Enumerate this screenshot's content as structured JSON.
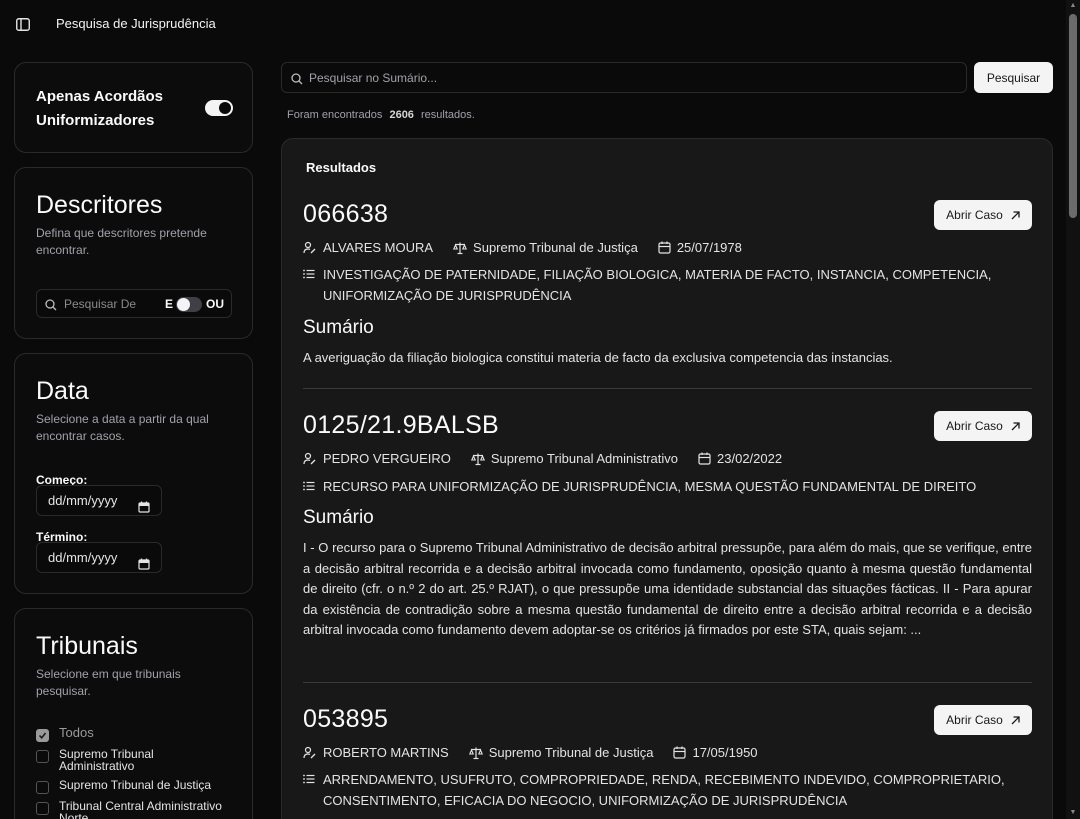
{
  "header": {
    "title": "Pesquisa de Jurisprudência"
  },
  "filters": {
    "toggle_label": "Apenas Acordãos Uniformizadores",
    "toggle_on": true,
    "descritores": {
      "title": "Descritores",
      "subtitle": "Defina que descritores pretende encontrar.",
      "search_placeholder": "Pesquisar Descritores",
      "and_label": "E",
      "or_label": "OU"
    },
    "data": {
      "title": "Data",
      "subtitle": "Selecione a data a partir da qual encontrar casos.",
      "start_label": "Começo:",
      "end_label": "Término:",
      "start_placeholder": "dd/mm/yyyy",
      "end_placeholder": "dd/mm/yyyy"
    },
    "tribunais": {
      "title": "Tribunais",
      "subtitle": "Selecione em que tribunais pesquisar.",
      "items": [
        {
          "label": "Todos",
          "checked": true
        },
        {
          "label": "Supremo Tribunal Administrativo",
          "checked": false
        },
        {
          "label": "Supremo Tribunal de Justiça",
          "checked": false
        },
        {
          "label": "Tribunal Central Administrativo Norte",
          "checked": false
        }
      ]
    }
  },
  "search": {
    "placeholder": "Pesquisar no Sumário...",
    "button_label": "Pesquisar",
    "found_prefix": "Foram encontrados",
    "found_count": "2606",
    "found_suffix": "resultados."
  },
  "results": {
    "title": "Resultados",
    "open_label": "Abrir Caso",
    "summary_heading": "Sumário",
    "items": [
      {
        "id": "066638",
        "relator": "ALVARES MOURA",
        "tribunal": "Supremo Tribunal de Justiça",
        "date": "25/07/1978",
        "tags": "INVESTIGAÇÃO DE PATERNIDADE, FILIAÇÃO BIOLOGICA, MATERIA DE FACTO, INSTANCIA, COMPETENCIA, UNIFORMIZAÇÃO DE JURISPRUDÊNCIA",
        "summary": "A averiguação da filiação biologica constitui materia de facto da exclusiva competencia das instancias."
      },
      {
        "id": "0125/21.9BALSB",
        "relator": "PEDRO VERGUEIRO",
        "tribunal": "Supremo Tribunal Administrativo",
        "date": "23/02/2022",
        "tags": "RECURSO PARA UNIFORMIZAÇÃO DE JURISPRUDÊNCIA, MESMA QUESTÃO FUNDAMENTAL DE DIREITO",
        "summary": "I - O recurso para o Supremo Tribunal Administrativo de decisão arbitral pressupõe, para além do mais, que se verifique, entre a decisão arbitral recorrida e a decisão arbitral invocada como fundamento, oposição quanto à mesma questão fundamental de direito (cfr. o n.º 2 do art. 25.º RJAT), o que pressupõe uma identidade substancial das situações fácticas. II - Para apurar da existência de contradição sobre a mesma questão fundamental de direito entre a decisão arbitral recorrida e a decisão arbitral invocada como fundamento devem adoptar-se os critérios já firmados por este STA, quais sejam: ..."
      },
      {
        "id": "053895",
        "relator": "ROBERTO MARTINS",
        "tribunal": "Supremo Tribunal de Justiça",
        "date": "17/05/1950",
        "tags": "ARRENDAMENTO, USUFRUTO, COMPROPRIEDADE, RENDA, RECEBIMENTO INDEVIDO, COMPROPRIETARIO, CONSENTIMENTO, EFICACIA DO NEGOCIO, UNIFORMIZAÇÃO DE JURISPRUDÊNCIA",
        "summary": ""
      }
    ]
  }
}
